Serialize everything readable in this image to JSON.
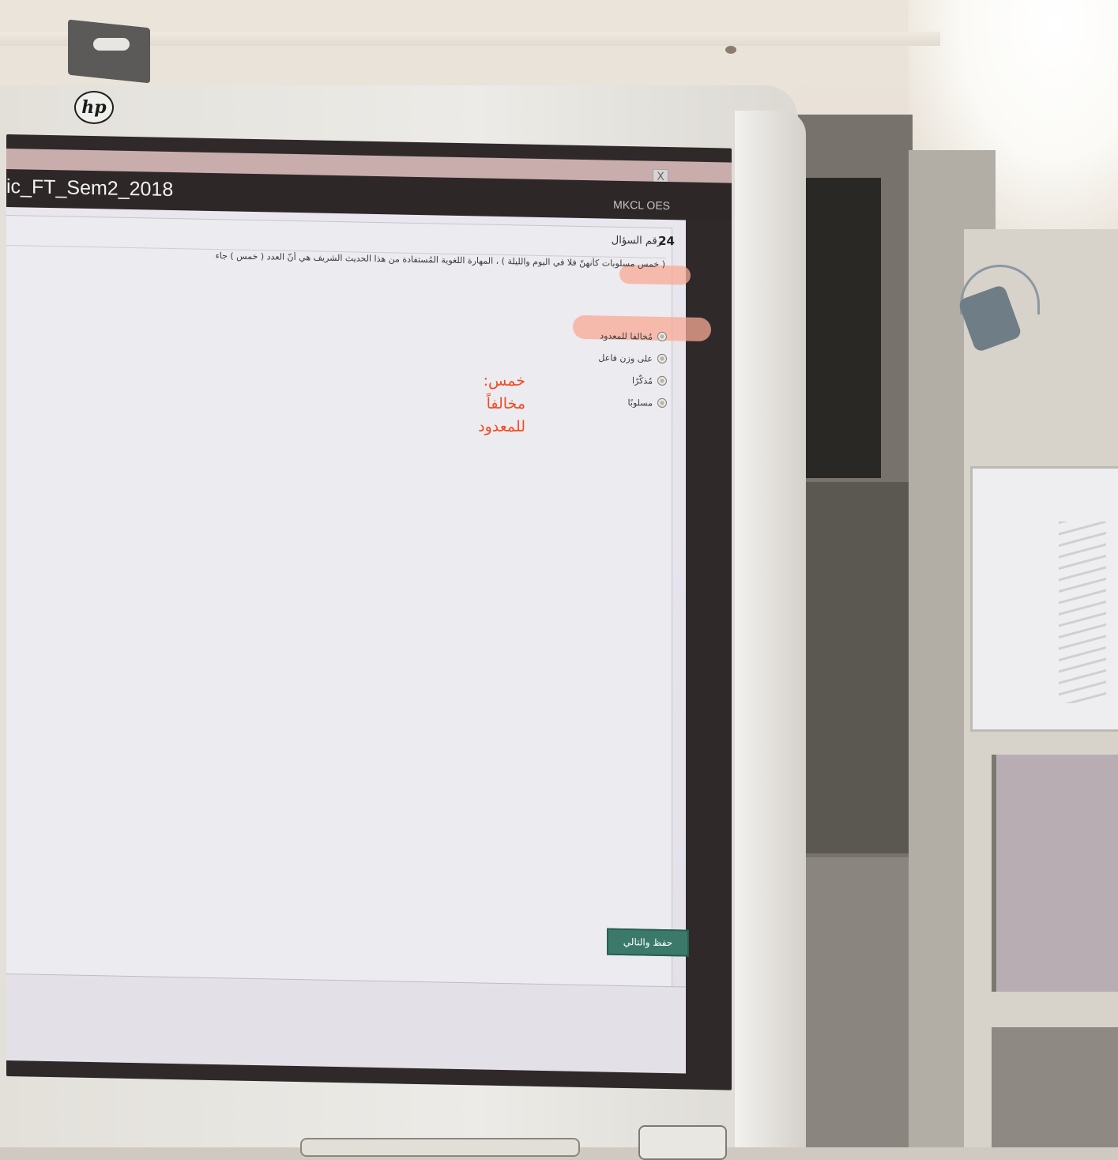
{
  "window": {
    "exam_title": "ic_FT_Sem2_2018",
    "brand": "MKCL OES",
    "close_label": "X"
  },
  "question": {
    "number_label": "رقم السؤال",
    "number_value": "24",
    "text": "( خمس مسلوبات كأنهنّ فلا في اليوم والليلة ) ، المهارة اللغوية المُستفادة من هذا الحديث الشريف هي أنّ العدد ( خمس ) جاء"
  },
  "options": [
    {
      "label": "مُخالفا للمعدود"
    },
    {
      "label": "على وزن فاعل"
    },
    {
      "label": "مُذكّرًا"
    },
    {
      "label": "مسلوبًا"
    }
  ],
  "buttons": {
    "save_next": "حفظ والتالي"
  },
  "annotation": {
    "line1": "خمس:",
    "line2": "مخالفاً",
    "line3": "للمعدود"
  },
  "hardware": {
    "brand_logo": "hp"
  },
  "colors": {
    "highlight": "#f8aa96",
    "annotation_text": "#f24a21",
    "primary_button": "#3b7a6b",
    "titlebar": "#2e2728"
  }
}
